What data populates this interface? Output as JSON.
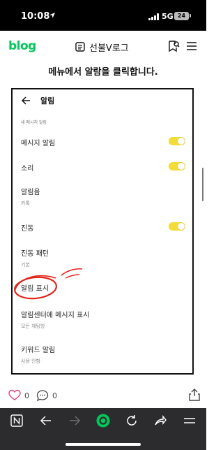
{
  "status_bar": {
    "time": "10:08",
    "network": "5G",
    "battery": "24"
  },
  "header": {
    "logo": "blog",
    "blog_title": "선불V로그"
  },
  "caption": "메뉴에서 알람을 클릭합니다.",
  "screenshot": {
    "title": "알림",
    "section_label": "새 메시지 알림",
    "rows": [
      {
        "title": "메시지 알림",
        "toggle": true
      },
      {
        "title": "소리",
        "toggle": true
      },
      {
        "title": "알림음",
        "subtitle": "카톡"
      },
      {
        "title": "진동",
        "toggle": true
      },
      {
        "title": "진동 패턴",
        "subtitle": "기본"
      },
      {
        "title": "알림 표시"
      },
      {
        "title": "알림센터에 메시지 표시",
        "subtitle": "모든 채팅방"
      },
      {
        "title": "키워드 알림",
        "subtitle": "사용 안함"
      }
    ],
    "toggle_color": "#f2dc3a",
    "annotation_color": "#e1251b"
  },
  "actions": {
    "like_count": "0",
    "comment_count": "0"
  },
  "colors": {
    "brand": "#03c75a",
    "browser_bar": "#2c2c2e",
    "browser_home": "#03c75a"
  },
  "icons": [
    "location-arrow-icon",
    "signal-icon",
    "battery-icon",
    "list-icon",
    "bookmark-search-icon",
    "menu-icon",
    "back-arrow-icon",
    "heart-icon",
    "comment-icon",
    "share-icon",
    "naver-n-icon",
    "forward-icon",
    "home-circle-icon",
    "refresh-icon",
    "share-arrow-icon"
  ]
}
